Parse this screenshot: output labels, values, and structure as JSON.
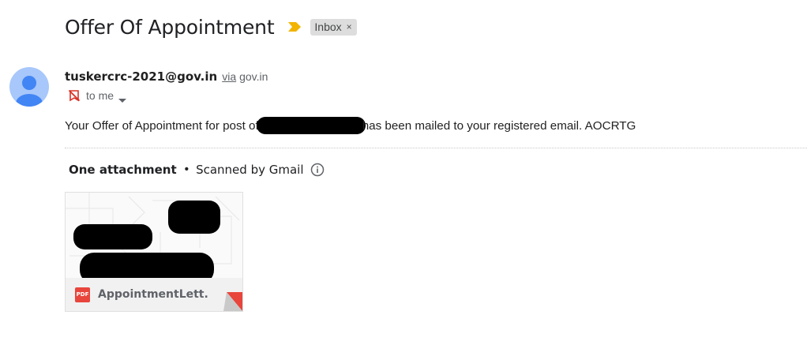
{
  "email": {
    "subject": "Offer Of Appointment",
    "label": "Inbox",
    "label_remove": "×",
    "sender_email": "tuskercrc-2021@gov.in",
    "via_label": "via",
    "via_domain": "gov.in",
    "recipient": "to me",
    "body_before": "Your Offer of Appointment for post of",
    "body_after": "has been mailed to your registered email. AOCRTG"
  },
  "attachments": {
    "count_label": "One attachment",
    "separator": "•",
    "scan_label": "Scanned by Gmail",
    "files": [
      {
        "name": "AppointmentLett...",
        "type_badge": "PDF"
      }
    ]
  },
  "colors": {
    "importance_marker": "#f2b400",
    "avatar_bg": "#a8c7fa",
    "avatar_fg": "#4285f4",
    "pdf_badge": "#e8453c",
    "label_chip_bg": "#dddddd"
  },
  "icons": {
    "importance": "importance-marker-icon",
    "spam_warning": "spam-warning-icon",
    "details_caret": "chevron-down-icon",
    "info": "info-icon",
    "file_type": "pdf-icon"
  }
}
